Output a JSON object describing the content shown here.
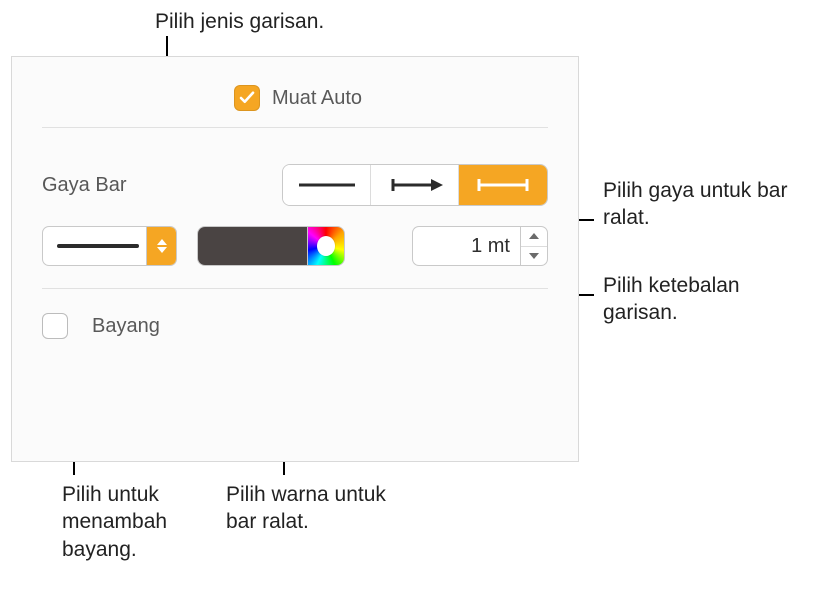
{
  "callouts": {
    "lineType": "Pilih jenis garisan.",
    "barStyle": "Pilih gaya untuk bar ralat.",
    "thickness": "Pilih ketebalan garisan.",
    "color": "Pilih warna untuk bar ralat.",
    "shadow": "Pilih untuk menambah bayang."
  },
  "panel": {
    "autoFitLabel": "Muat Auto",
    "barStyleLabel": "Gaya Bar",
    "shadowLabel": "Bayang",
    "thicknessValue": "1 mt",
    "lineColor": "#4a4443",
    "accentColor": "#f5a623",
    "segmented": {
      "selectedIndex": 2
    }
  }
}
